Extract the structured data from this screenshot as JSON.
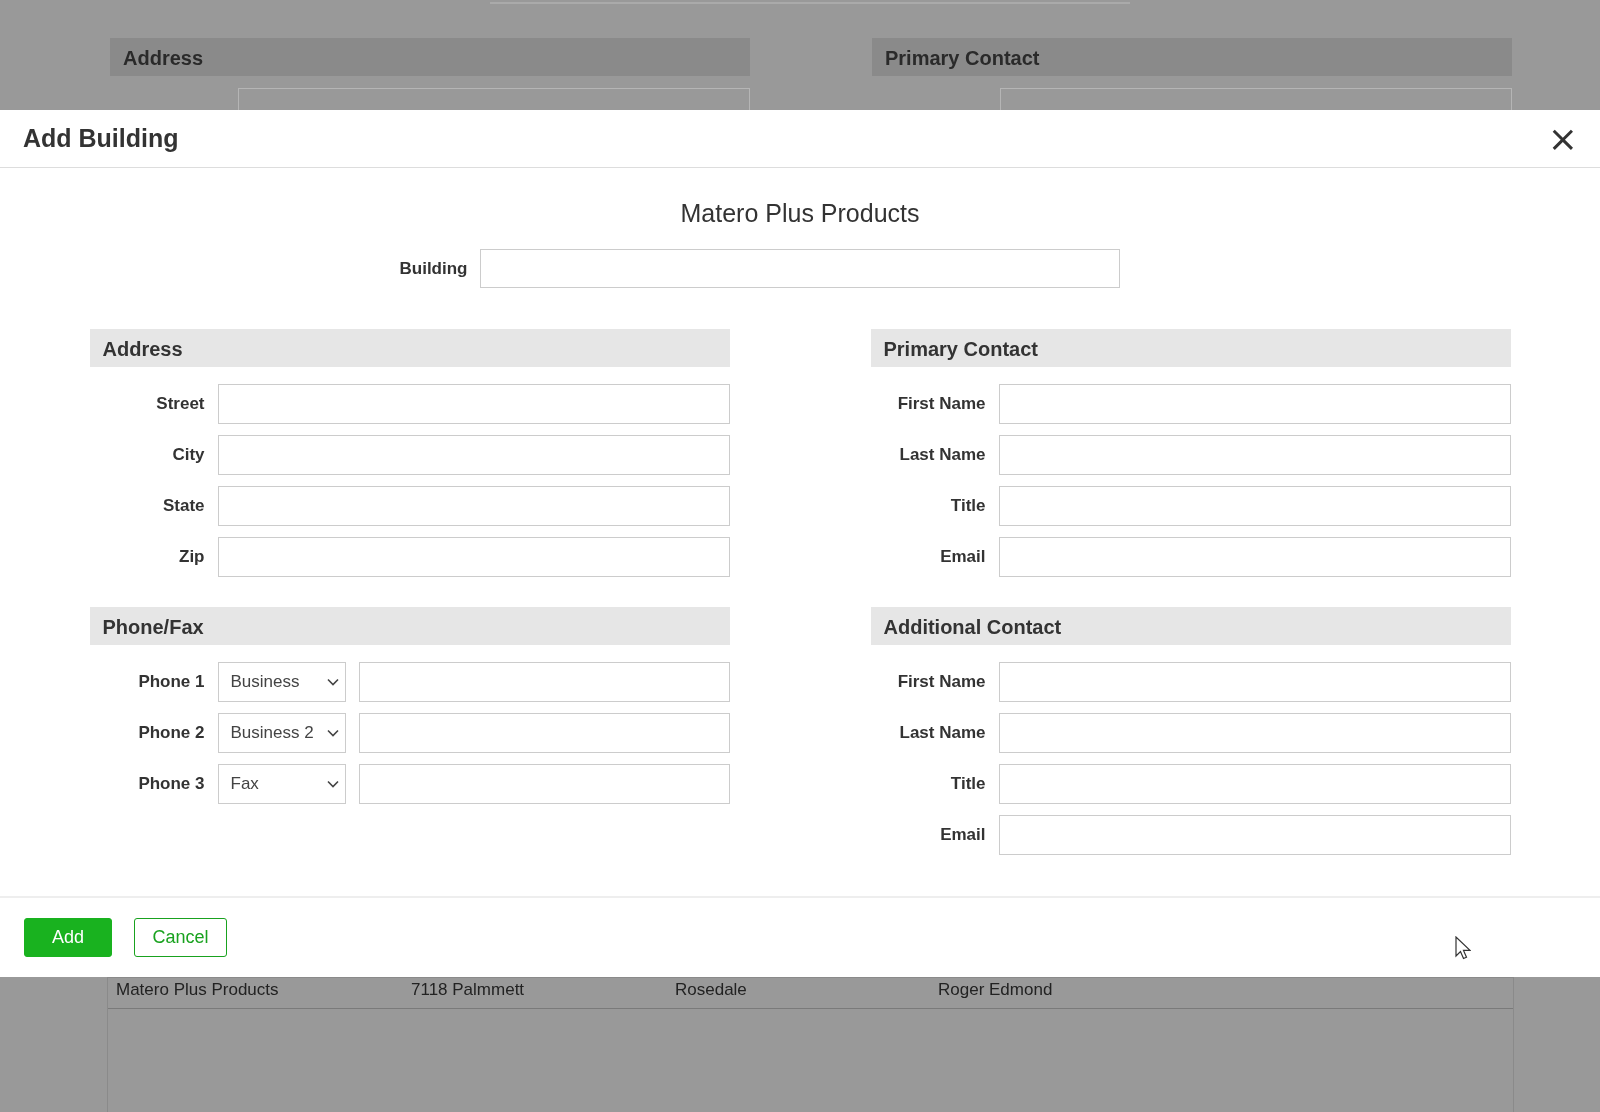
{
  "background": {
    "sections": [
      {
        "title": "Address"
      },
      {
        "title": "Primary Contact"
      }
    ],
    "table_row": [
      "Matero Plus Products",
      "7118 Palmmett",
      "Rosedale",
      "Roger Edmond"
    ]
  },
  "dialog": {
    "title": "Add Building",
    "close": "×",
    "company": "Matero Plus Products",
    "building_label": "Building",
    "columns": [
      [
        {
          "title": "Address",
          "fields": [
            {
              "label": "Street",
              "kind": "text"
            },
            {
              "label": "City",
              "kind": "text"
            },
            {
              "label": "State",
              "kind": "text"
            },
            {
              "label": "Zip",
              "kind": "text"
            }
          ]
        },
        {
          "title": "Phone/Fax",
          "fields": [
            {
              "label": "Phone 1",
              "kind": "phone",
              "type": "Business"
            },
            {
              "label": "Phone 2",
              "kind": "phone",
              "type": "Business 2"
            },
            {
              "label": "Phone 3",
              "kind": "phone",
              "type": "Fax"
            }
          ]
        }
      ],
      [
        {
          "title": "Primary Contact",
          "fields": [
            {
              "label": "First Name",
              "kind": "text"
            },
            {
              "label": "Last Name",
              "kind": "text"
            },
            {
              "label": "Title",
              "kind": "text"
            },
            {
              "label": "Email",
              "kind": "text"
            }
          ]
        },
        {
          "title": "Additional Contact",
          "fields": [
            {
              "label": "First Name",
              "kind": "text"
            },
            {
              "label": "Last Name",
              "kind": "text"
            },
            {
              "label": "Title",
              "kind": "text"
            },
            {
              "label": "Email",
              "kind": "text"
            }
          ]
        }
      ]
    ],
    "buttons": [
      {
        "label": "Add",
        "kind": "primary"
      },
      {
        "label": "Cancel",
        "kind": "secondary"
      }
    ]
  }
}
